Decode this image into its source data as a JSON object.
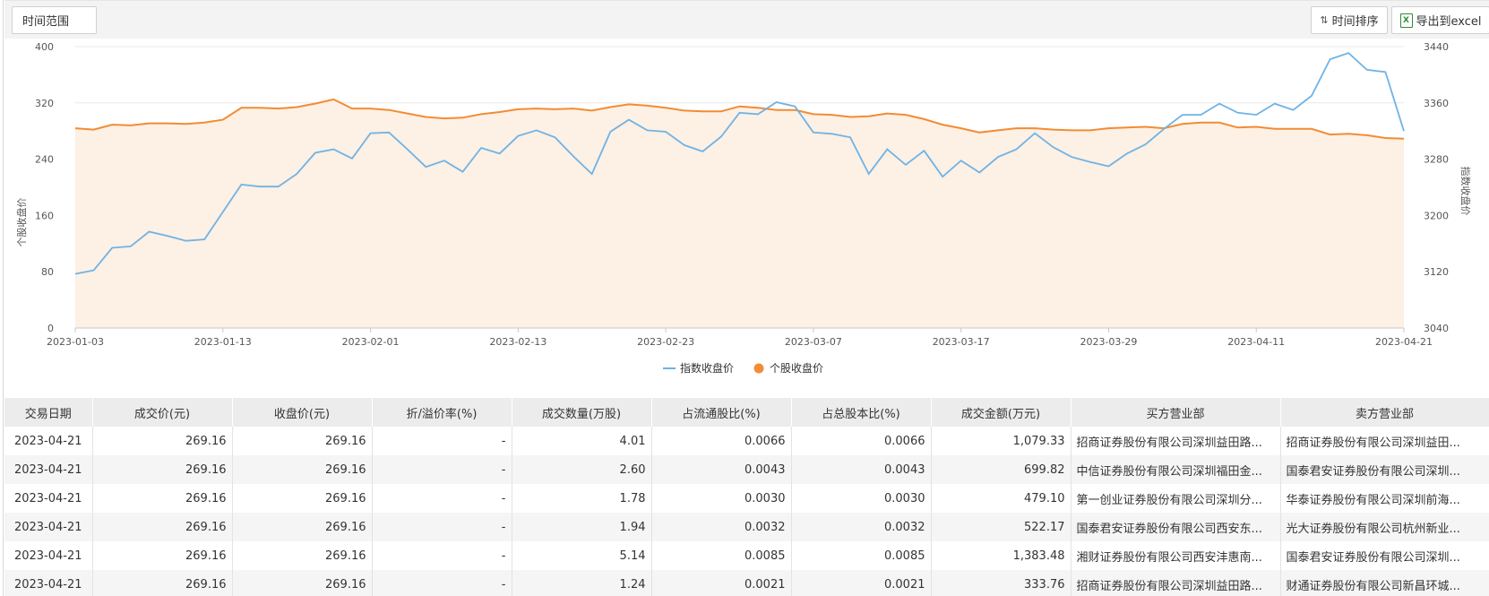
{
  "toolbar": {
    "time_range_label": "时间范围",
    "sort_label": "时间排序",
    "export_label": "导出到excel"
  },
  "chart_data": {
    "type": "line",
    "x_tick_labels": [
      "2023-01-03",
      "2023-01-13",
      "2023-02-01",
      "2023-02-13",
      "2023-02-23",
      "2023-03-07",
      "2023-03-17",
      "2023-03-29",
      "2023-04-11",
      "2023-04-21"
    ],
    "y_left": {
      "label": "个股收盘价",
      "ticks": [
        0,
        80,
        160,
        240,
        320,
        400
      ],
      "range": [
        0,
        400
      ]
    },
    "y_right": {
      "label": "指数收盘价",
      "ticks": [
        3040,
        3120,
        3200,
        3280,
        3360,
        3440
      ],
      "range": [
        3040,
        3440
      ]
    },
    "legend": [
      "指数收盘价",
      "个股收盘价"
    ],
    "legend_position": "bottom",
    "colors": {
      "index": "#6eb3e6",
      "stock": "#f28c35",
      "area": "#fdf0e4"
    },
    "series": [
      {
        "name": "个股收盘价",
        "axis": "left",
        "values": [
          284,
          282,
          289,
          288,
          291,
          291,
          290,
          292,
          296,
          313,
          313,
          312,
          314,
          319,
          325,
          312,
          312,
          310,
          305,
          300,
          298,
          299,
          304,
          307,
          311,
          312,
          311,
          312,
          309,
          314,
          318,
          316,
          313,
          309,
          308,
          308,
          315,
          313,
          310,
          310,
          304,
          303,
          300,
          301,
          305,
          303,
          297,
          289,
          284,
          278,
          281,
          284,
          284,
          282,
          281,
          281,
          284,
          285,
          286,
          284,
          290,
          292,
          292,
          285,
          286,
          283,
          283,
          283,
          275,
          276,
          274,
          270,
          269
        ]
      },
      {
        "name": "指数收盘价",
        "axis": "right",
        "values": [
          3117,
          3122,
          3154,
          3156,
          3177,
          3171,
          3164,
          3166,
          3205,
          3244,
          3241,
          3241,
          3259,
          3289,
          3294,
          3281,
          3317,
          3318,
          3294,
          3269,
          3278,
          3262,
          3296,
          3288,
          3313,
          3321,
          3311,
          3284,
          3259,
          3319,
          3336,
          3321,
          3319,
          3300,
          3291,
          3312,
          3346,
          3344,
          3361,
          3355,
          3318,
          3316,
          3311,
          3259,
          3294,
          3272,
          3292,
          3255,
          3278,
          3261,
          3283,
          3294,
          3317,
          3297,
          3283,
          3276,
          3270,
          3288,
          3301,
          3323,
          3343,
          3343,
          3359,
          3346,
          3343,
          3359,
          3350,
          3370,
          3422,
          3431,
          3407,
          3404,
          3320
        ]
      }
    ]
  },
  "table": {
    "headers": [
      "交易日期",
      "成交价(元)",
      "收盘价(元)",
      "折/溢价率(%)",
      "成交数量(万股)",
      "占流通股比(%)",
      "占总股本比(%)",
      "成交金额(万元)",
      "买方营业部",
      "卖方营业部"
    ],
    "rows": [
      [
        "2023-04-21",
        "269.16",
        "269.16",
        "-",
        "4.01",
        "0.0066",
        "0.0066",
        "1,079.33",
        "招商证券股份有限公司深圳益田路...",
        "招商证券股份有限公司深圳益田..."
      ],
      [
        "2023-04-21",
        "269.16",
        "269.16",
        "-",
        "2.60",
        "0.0043",
        "0.0043",
        "699.82",
        "中信证券股份有限公司深圳福田金...",
        "国泰君安证券股份有限公司深圳..."
      ],
      [
        "2023-04-21",
        "269.16",
        "269.16",
        "-",
        "1.78",
        "0.0030",
        "0.0030",
        "479.10",
        "第一创业证券股份有限公司深圳分...",
        "华泰证券股份有限公司深圳前海..."
      ],
      [
        "2023-04-21",
        "269.16",
        "269.16",
        "-",
        "1.94",
        "0.0032",
        "0.0032",
        "522.17",
        "国泰君安证券股份有限公司西安东...",
        "光大证券股份有限公司杭州新业..."
      ],
      [
        "2023-04-21",
        "269.16",
        "269.16",
        "-",
        "5.14",
        "0.0085",
        "0.0085",
        "1,383.48",
        "湘财证券股份有限公司西安沣惠南...",
        "国泰君安证券股份有限公司深圳..."
      ],
      [
        "2023-04-21",
        "269.16",
        "269.16",
        "-",
        "1.24",
        "0.0021",
        "0.0021",
        "333.76",
        "招商证券股份有限公司深圳益田路...",
        "财通证券股份有限公司新昌环城..."
      ]
    ]
  }
}
